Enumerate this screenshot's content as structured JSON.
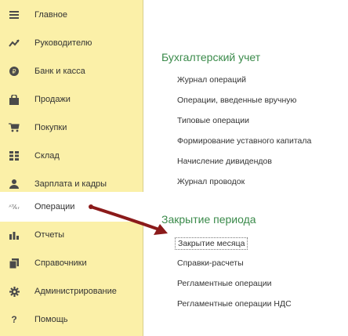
{
  "sidebar": {
    "items": [
      {
        "label": "Главное",
        "icon": "list-icon"
      },
      {
        "label": "Руководителю",
        "icon": "trend-icon"
      },
      {
        "label": "Банк и касса",
        "icon": "coin-icon"
      },
      {
        "label": "Продажи",
        "icon": "bag-icon"
      },
      {
        "label": "Покупки",
        "icon": "cart-icon"
      },
      {
        "label": "Склад",
        "icon": "grid-icon"
      },
      {
        "label": "Зарплата и кадры",
        "icon": "person-icon"
      },
      {
        "label": "Операции",
        "icon": "operations-icon",
        "operations_glyph": "ᴬᵀ⁄ₖᵣ"
      },
      {
        "label": "Отчеты",
        "icon": "bar-chart-icon"
      },
      {
        "label": "Справочники",
        "icon": "books-icon"
      },
      {
        "label": "Администрирование",
        "icon": "gear-icon"
      },
      {
        "label": "Помощь",
        "icon": "help-icon",
        "glyph": "?"
      }
    ]
  },
  "sections": [
    {
      "title": "Бухгалтерский учет",
      "links": [
        "Журнал операций",
        "Операции, введенные вручную",
        "Типовые операции",
        "Формирование уставного капитала",
        "Начисление дивидендов",
        "Журнал проводок"
      ]
    },
    {
      "title": "Закрытие периода",
      "links": [
        "Закрытие месяца",
        "Справки-расчеты",
        "Регламентные операции",
        "Регламентные операции НДС"
      ]
    }
  ],
  "colors": {
    "sidebar_bg": "#fbf0a8",
    "section_title": "#3a8a4a",
    "arrow": "#8b1a1a"
  }
}
